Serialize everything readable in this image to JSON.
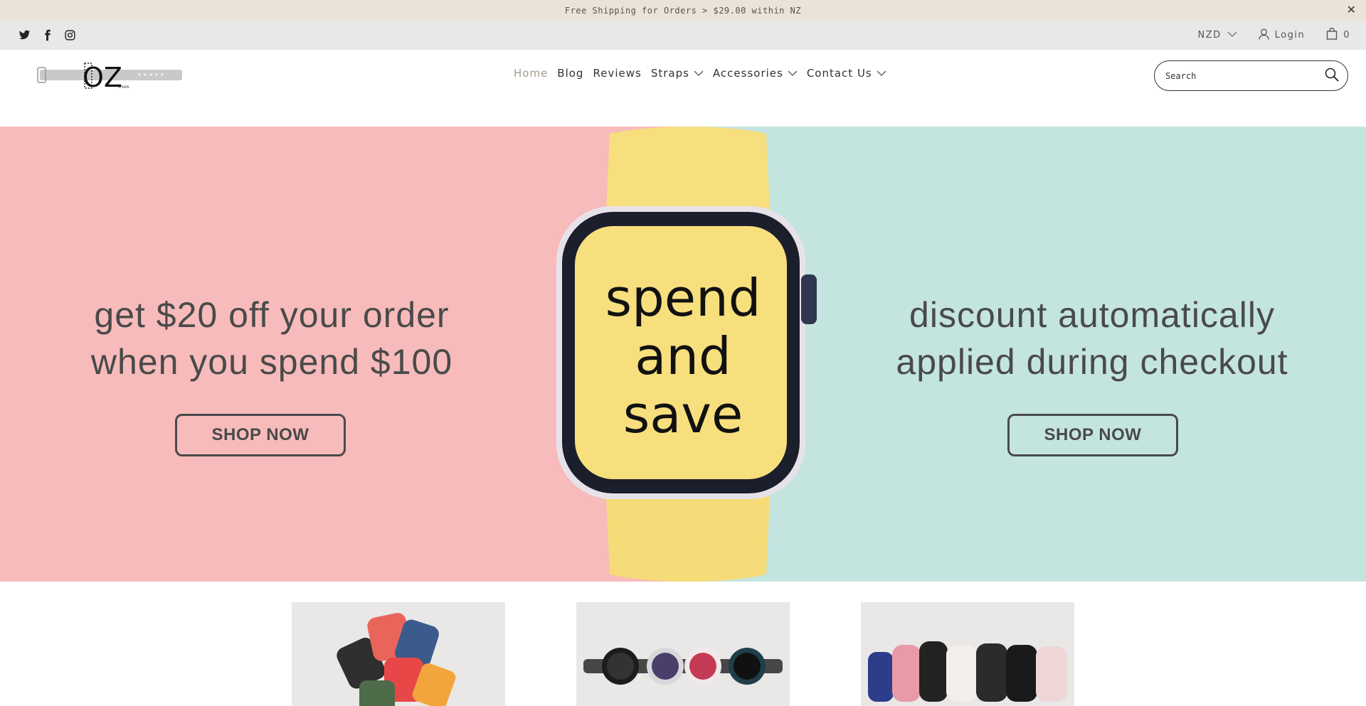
{
  "announcement": {
    "text": "Free Shipping for Orders > $29.00 within NZ",
    "close_symbol": "✕"
  },
  "social": {
    "icons": [
      "twitter-icon",
      "facebook-icon",
      "instagram-icon"
    ]
  },
  "utility": {
    "currency": "NZD",
    "login_label": "Login",
    "cart_count": "0"
  },
  "header": {
    "logo_text": "OZ",
    "logo_subtext": "STRAPS",
    "nav": [
      {
        "label": "Home",
        "active": true
      },
      {
        "label": "Blog"
      },
      {
        "label": "Reviews"
      },
      {
        "label": "Straps",
        "dropdown": true
      },
      {
        "label": "Accessories",
        "dropdown": true
      },
      {
        "label": "Contact Us",
        "dropdown": true
      }
    ],
    "search_placeholder": "Search"
  },
  "hero": {
    "left_line1": "get $20 off your order",
    "left_line2": "when you spend $100",
    "left_button": "SHOP NOW",
    "watch_line1": "spend",
    "watch_line2": "and",
    "watch_line3": "save",
    "right_line1": "discount automatically",
    "right_line2": "applied during checkout",
    "right_button": "SHOP NOW",
    "colors": {
      "left_bg": "#f7bbbb",
      "right_bg": "#c4e5df",
      "watch_band": "#f7df7e"
    }
  },
  "tiles": [
    {
      "name": "apple-watch-bands"
    },
    {
      "name": "samsung-watch-bands"
    },
    {
      "name": "fitbit-watch-bands"
    }
  ]
}
